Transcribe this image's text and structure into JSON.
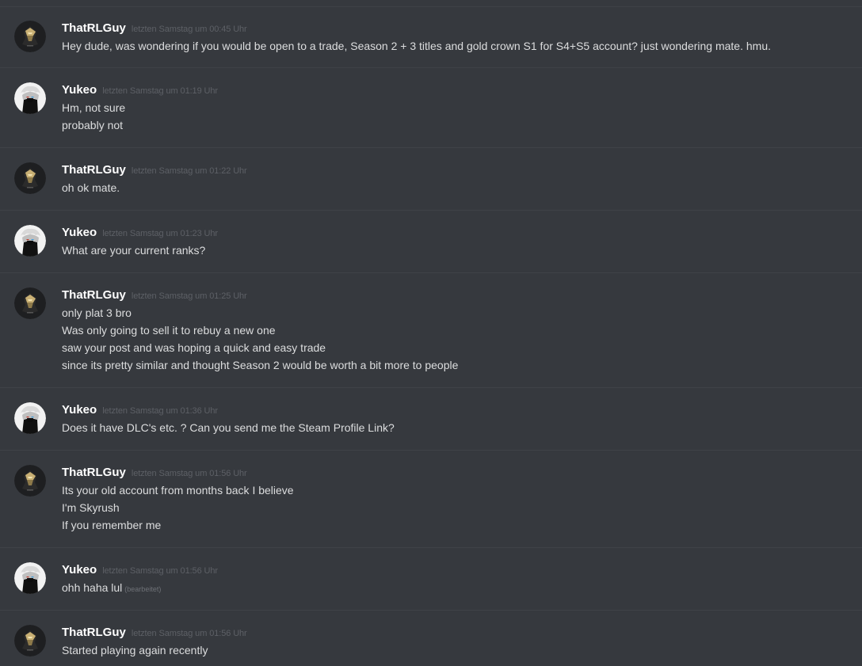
{
  "messages": [
    {
      "author": "ThatRLGuy",
      "avatar": "hooded-figure-gold",
      "timestamp": "letzten Samstag um 00:45 Uhr",
      "lines": [
        "Hey dude, was wondering if you would be open to a trade, Season 2 + 3 titles and gold crown S1 for S4+S5 account? just wondering mate. hmu."
      ]
    },
    {
      "author": "Yukeo",
      "avatar": "anime-white-hair",
      "timestamp": "letzten Samstag um 01:19 Uhr",
      "lines": [
        "Hm, not sure",
        "probably not"
      ]
    },
    {
      "author": "ThatRLGuy",
      "avatar": "hooded-figure-gold",
      "timestamp": "letzten Samstag um 01:22 Uhr",
      "lines": [
        "oh ok mate."
      ]
    },
    {
      "author": "Yukeo",
      "avatar": "anime-white-hair",
      "timestamp": "letzten Samstag um 01:23 Uhr",
      "lines": [
        "What are your current ranks?"
      ]
    },
    {
      "author": "ThatRLGuy",
      "avatar": "hooded-figure-gold",
      "timestamp": "letzten Samstag um 01:25 Uhr",
      "lines": [
        "only plat 3 bro",
        "Was only going to sell it to rebuy a new one",
        "saw your post and was hoping a quick and easy trade",
        "since its pretty similar and thought Season 2 would be worth a bit more to people"
      ]
    },
    {
      "author": "Yukeo",
      "avatar": "anime-white-hair",
      "timestamp": "letzten Samstag um 01:36 Uhr",
      "lines": [
        "Does it have DLC's etc. ? Can you send me the Steam Profile Link?"
      ]
    },
    {
      "author": "ThatRLGuy",
      "avatar": "hooded-figure-gold",
      "timestamp": "letzten Samstag um 01:56 Uhr",
      "lines": [
        "Its your old account from months back I believe",
        "I'm Skyrush",
        "If you remember me"
      ]
    },
    {
      "author": "Yukeo",
      "avatar": "anime-white-hair",
      "timestamp": "letzten Samstag um 01:56 Uhr",
      "lines": [
        "ohh haha lul"
      ],
      "edited_label": "(bearbeitet)"
    },
    {
      "author": "ThatRLGuy",
      "avatar": "hooded-figure-gold",
      "timestamp": "letzten Samstag um 01:56 Uhr",
      "lines": [
        "Started playing again recently"
      ]
    }
  ],
  "colors": {
    "background": "#36393e",
    "username": "#ffffff",
    "message_text": "#dcddde",
    "timestamp": "#5d6066",
    "divider": "#3f4247"
  }
}
